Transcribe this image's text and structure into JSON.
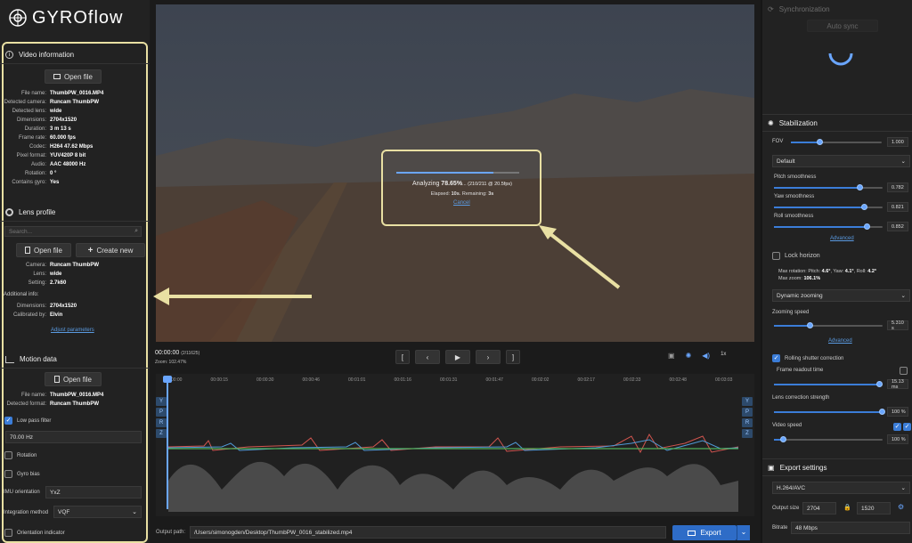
{
  "app": {
    "logo": "GYROflow"
  },
  "video_info": {
    "title": "Video information",
    "open_label": "Open file",
    "rows": [
      {
        "k": "File name:",
        "v": "ThumbPW_0016.MP4"
      },
      {
        "k": "Detected camera:",
        "v": "Runcam ThumbPW"
      },
      {
        "k": "Detected lens:",
        "v": "wide"
      },
      {
        "k": "Dimensions:",
        "v": "2704x1520"
      },
      {
        "k": "Duration:",
        "v": "3 m 13 s"
      },
      {
        "k": "Frame rate:",
        "v": "60.000 fps"
      },
      {
        "k": "Codec:",
        "v": "H264 47.62 Mbps"
      },
      {
        "k": "Pixel format:",
        "v": "YUV420P 8 bit"
      },
      {
        "k": "Audio:",
        "v": "AAC 48000 Hz"
      },
      {
        "k": "Rotation:",
        "v": "0 °"
      },
      {
        "k": "Contains gyro:",
        "v": "Yes"
      }
    ]
  },
  "lens": {
    "title": "Lens profile",
    "search_placeholder": "Search...",
    "open_label": "Open file",
    "create_label": "Create new",
    "rows": [
      {
        "k": "Camera:",
        "v": "Runcam ThumbPW"
      },
      {
        "k": "Lens:",
        "v": "wide"
      },
      {
        "k": "Setting:",
        "v": "2.7k60"
      }
    ],
    "additional_label": "Additional info:",
    "rows2": [
      {
        "k": "Dimensions:",
        "v": "2704x1520"
      },
      {
        "k": "Calibrated by:",
        "v": "Elvin"
      }
    ],
    "adjust_label": "Adjust parameters"
  },
  "motion": {
    "title": "Motion data",
    "open_label": "Open file",
    "rows": [
      {
        "k": "File name:",
        "v": "ThumbPW_0016.MP4"
      },
      {
        "k": "Detected format:",
        "v": "Runcam ThumbPW"
      }
    ],
    "lowpass_label": "Low pass filter",
    "lowpass_value": "70.00 Hz",
    "rotation_label": "Rotation",
    "gyrobias_label": "Gyro bias",
    "imu_label": "IMU orientation",
    "imu_value": "YxZ",
    "integration_label": "Integration method",
    "integration_value": "VQF",
    "orient_label": "Orientation indicator"
  },
  "player": {
    "time": "00:00:00",
    "frames": "(2/11625)",
    "zoom": "Zoom: 102.47%",
    "speed": "1x"
  },
  "analysis": {
    "prefix": "Analyzing ",
    "percent": "78.65%",
    "suffix": "... (210/211 @ 20.5fps)",
    "elapsed_label": "Elapsed: ",
    "elapsed": "10s",
    "remaining_label": ". Remaining: ",
    "remaining": "3s",
    "cancel": "Cancel",
    "progress": 0.7865
  },
  "timeline": {
    "ticks": [
      "00:00:00",
      "00:00:15",
      "00:00:30",
      "00:00:46",
      "00:01:01",
      "00:01:16",
      "00:01:31",
      "00:01:47",
      "00:02:02",
      "00:02:17",
      "00:02:33",
      "00:02:48",
      "00:03:03"
    ],
    "axis_buttons": [
      "Y",
      "P",
      "R",
      "Z"
    ]
  },
  "output": {
    "label": "Output path:",
    "path": "/Users/simonogden/Desktop/ThumbPW_0016_stabilized.mp4",
    "export_label": "Export"
  },
  "sync": {
    "title": "Synchronization",
    "auto_label": "Auto sync"
  },
  "stab": {
    "title": "Stabilization",
    "fov_label": "FOV",
    "fov_value": "1.000",
    "method": "Default",
    "pitch_label": "Pitch smoothness",
    "pitch_value": "0.782",
    "yaw_label": "Yaw smoothness",
    "yaw_value": "0.821",
    "roll_label": "Roll smoothness",
    "roll_value": "0.852",
    "advanced_label": "Advanced",
    "lock_label": "Lock horizon",
    "maxrot_prefix": "Max rotation: Pitch: ",
    "maxrot_pitch": "4.6°",
    "maxrot_yaw_prefix": ", Yaw: ",
    "maxrot_yaw": "4.1°",
    "maxrot_roll_prefix": ", Roll: ",
    "maxrot_roll": "4.2°",
    "maxzoom_prefix": "Max zoom: ",
    "maxzoom": "106.1%",
    "dynamic_label": "Dynamic zooming",
    "zoomspeed_label": "Zooming speed",
    "zoomspeed_value": "5.310 s",
    "advanced2_label": "Advanced",
    "rs_label": "Rolling shutter correction",
    "frame_readout_label": "Frame readout time",
    "frame_readout_value": "15.13 ms",
    "lens_corr_label": "Lens correction strength",
    "lens_corr_value": "100 %",
    "video_speed_label": "Video speed",
    "video_speed_value": "100 %"
  },
  "export": {
    "title": "Export settings",
    "codec": "H.264/AVC",
    "size_label": "Output size",
    "width": "2704",
    "height": "1520",
    "bitrate_label": "Bitrate",
    "bitrate": "48 Mbps"
  },
  "colors": {
    "accent": "#3b7dd8",
    "annotation": "#e9e0a3"
  }
}
